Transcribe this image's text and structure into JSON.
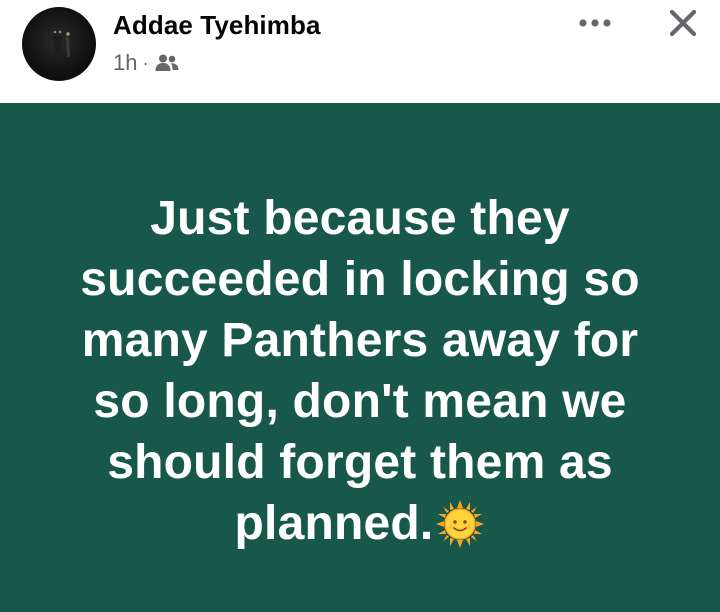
{
  "post": {
    "author": "Addae Tyehimba",
    "time": "1h",
    "separator": "·",
    "audience_icon": "friends-icon",
    "more_icon": "more-options-icon",
    "close_icon": "close-icon",
    "text_lines": [
      "Just because they",
      "succeeded in locking so",
      "many Panthers away for",
      "so long, don't mean we",
      "should forget them as",
      "planned."
    ],
    "emoji": "sun-with-face-emoji",
    "background_color": "#17584b",
    "text_color": "#ffffff"
  }
}
